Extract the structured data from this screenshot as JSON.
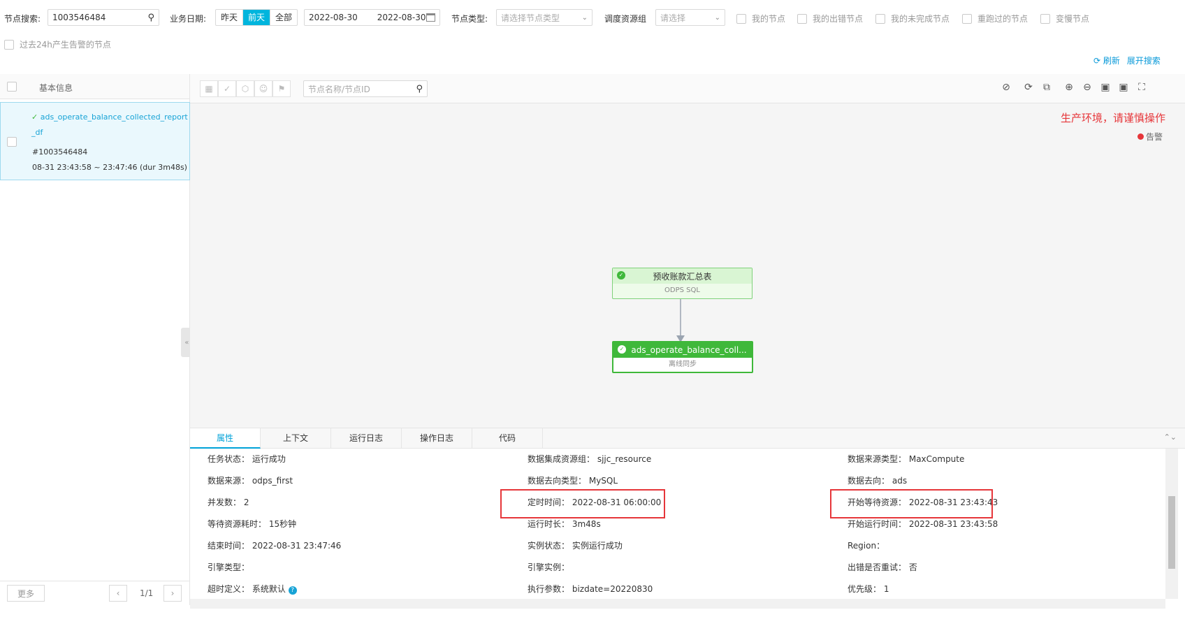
{
  "filters": {
    "node_search_label": "节点搜索:",
    "node_search_value": "1003546484",
    "biz_date_label": "业务日期:",
    "date_options": [
      "昨天",
      "前天",
      "全部"
    ],
    "date_active": "前天",
    "date_start": "2022-08-30",
    "date_end": "2022-08-30",
    "node_type_label": "节点类型:",
    "node_type_placeholder": "请选择节点类型",
    "resource_group_label": "调度资源组",
    "resource_group_placeholder": "请选择",
    "checkboxes": [
      "我的节点",
      "我的出错节点",
      "我的未完成节点",
      "重跑过的节点",
      "变慢节点"
    ],
    "alert_checkbox": "过去24h产生告警的节点",
    "refresh": "刷新",
    "expand": "展开搜索"
  },
  "left": {
    "header": "基本信息",
    "item": {
      "name_line1": "ads_operate_balance_collected_report",
      "name_line2": "_df",
      "id": "#1003546484",
      "time": "08-31 23:43:58 ~ 23:47:46 (dur 3m48s)"
    },
    "more": "更多",
    "page": "1/1"
  },
  "graph": {
    "search_placeholder": "节点名称/节点ID",
    "warning": "生产环境，请谨慎操作",
    "alert_legend": "告警",
    "node1": {
      "title": "预收账款汇总表",
      "subtitle": "ODPS SQL"
    },
    "node2": {
      "title": "ads_operate_balance_coll...",
      "subtitle": "离线同步"
    }
  },
  "tabs": [
    "属性",
    "上下文",
    "运行日志",
    "操作日志",
    "代码"
  ],
  "props": {
    "c1": [
      {
        "k": "任务状态：",
        "v": "运行成功"
      },
      {
        "k": "数据来源：",
        "v": "odps_first"
      },
      {
        "k": "并发数：",
        "v": "2"
      },
      {
        "k": "等待资源耗时：",
        "v": "15秒钟"
      },
      {
        "k": "结束时间：",
        "v": "2022-08-31 23:47:46"
      },
      {
        "k": "引擎类型：",
        "v": ""
      },
      {
        "k": "超时定义：",
        "v": "系统默认"
      }
    ],
    "c2": [
      {
        "k": "数据集成资源组：",
        "v": "sjjc_resource"
      },
      {
        "k": "数据去向类型：",
        "v": "MySQL"
      },
      {
        "k": "定时时间：",
        "v": "2022-08-31 06:00:00"
      },
      {
        "k": "运行时长：",
        "v": "3m48s"
      },
      {
        "k": "实例状态：",
        "v": "实例运行成功"
      },
      {
        "k": "引擎实例：",
        "v": ""
      },
      {
        "k": "执行参数：",
        "v": "bizdate=20220830"
      }
    ],
    "c3": [
      {
        "k": "数据来源类型：",
        "v": "MaxCompute"
      },
      {
        "k": "数据去向：",
        "v": "ads"
      },
      {
        "k": "开始等待资源：",
        "v": "2022-08-31 23:43:43"
      },
      {
        "k": "开始运行时间：",
        "v": "2022-08-31 23:43:58"
      },
      {
        "k": "Region：",
        "v": ""
      },
      {
        "k": "出错是否重试：",
        "v": "否"
      },
      {
        "k": "优先级：",
        "v": "1"
      }
    ]
  }
}
